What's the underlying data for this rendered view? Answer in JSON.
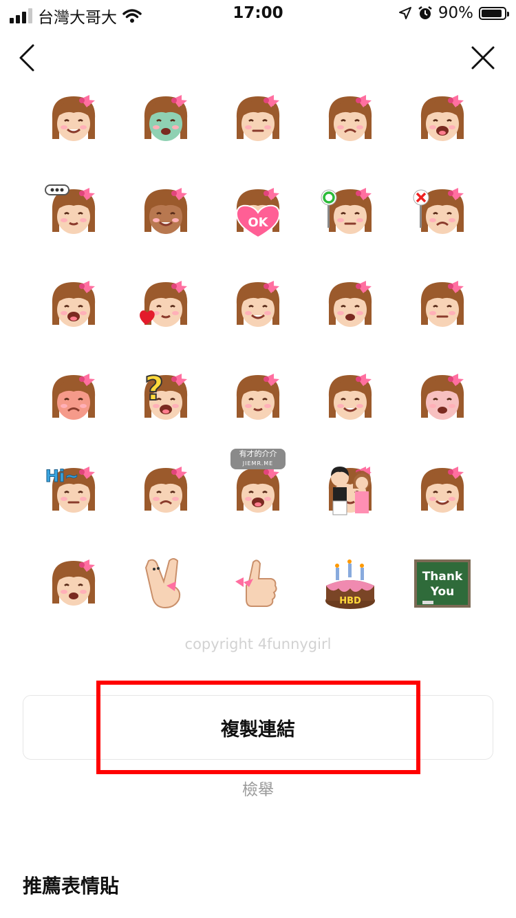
{
  "status_bar": {
    "carrier": "台灣大哥大",
    "time": "17:00",
    "battery": "90%",
    "battery_level": 0.9
  },
  "nav": {
    "back_icon": "chevron-left-icon",
    "close_icon": "close-icon"
  },
  "stickers": [
    [
      "sticker-hungry-spoon-fork",
      "sticker-shocked-green",
      "sticker-laugh-crying",
      "sticker-worried",
      "sticker-gritted-teeth"
    ],
    [
      "sticker-speechless-dots",
      "sticker-tan-smirk",
      "sticker-ok-heart",
      "sticker-circle-sign",
      "sticker-cross-sign"
    ],
    [
      "sticker-hands-face-sparkle",
      "sticker-kiss-heart",
      "sticker-grin-sparkle",
      "sticker-chin-hands",
      "sticker-tongue-out"
    ],
    [
      "sticker-angry-huff",
      "sticker-question-mark",
      "sticker-nose-pick",
      "sticker-nervous-sweat",
      "sticker-embarrassed"
    ],
    [
      "sticker-hi-wave",
      "sticker-dizzy-eyes",
      "sticker-crying-loud",
      "sticker-couple",
      "sticker-sigh"
    ],
    [
      "sticker-content-smile",
      "sticker-peace-sign",
      "sticker-thumbs-up",
      "sticker-hbd-cake",
      "sticker-thank-you-board"
    ]
  ],
  "watermark": {
    "line1": "有才的介介",
    "line2": "JIEMR.ME"
  },
  "copyright": "copyright 4funnygirl",
  "copy_link_label": "複製連結",
  "report_label": "檢舉",
  "recommended_title": "推薦表情貼"
}
